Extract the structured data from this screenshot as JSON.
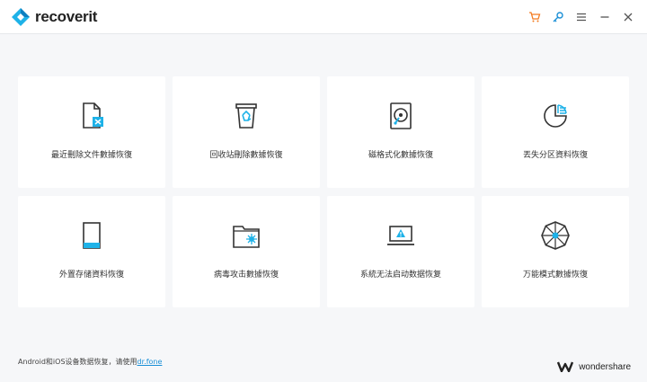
{
  "app": {
    "name": "recoverit",
    "accent": "#1eb2e8",
    "cart_color": "#f47b20"
  },
  "titlebar": {
    "icons": [
      "cart-icon",
      "key-icon",
      "menu-icon",
      "minimize-icon",
      "close-icon"
    ]
  },
  "cards": [
    {
      "label": "最近刪除文件數據恢復",
      "icon": "deleted-file-icon"
    },
    {
      "label": "回收站刪除數據恢復",
      "icon": "recycle-bin-icon"
    },
    {
      "label": "磁格式化數據恢復",
      "icon": "hard-drive-icon"
    },
    {
      "label": "丟失分区資料恢復",
      "icon": "partition-icon"
    },
    {
      "label": "外置存储資料恢復",
      "icon": "external-device-icon"
    },
    {
      "label": "病毒攻击數據恢復",
      "icon": "virus-folder-icon"
    },
    {
      "label": "系統无法启动数据恢复",
      "icon": "system-crash-icon"
    },
    {
      "label": "万能模式數據恢復",
      "icon": "all-round-icon"
    }
  ],
  "footer": {
    "text": "Android和iOS设备数据恢复，请使用",
    "link": "dr.fone",
    "brand": "wondershare"
  }
}
